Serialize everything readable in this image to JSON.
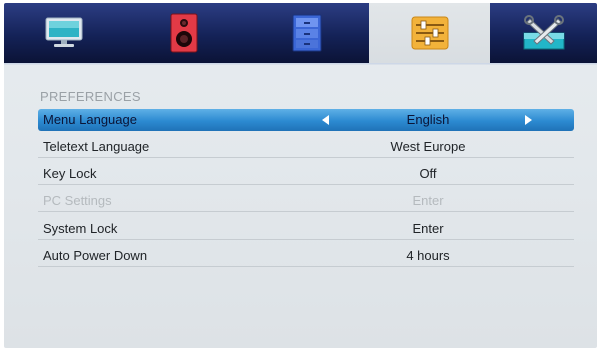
{
  "tabs": [
    {
      "icon": "monitor-icon",
      "active": false
    },
    {
      "icon": "speaker-icon",
      "active": false
    },
    {
      "icon": "cabinet-icon",
      "active": false
    },
    {
      "icon": "sliders-icon",
      "active": true
    },
    {
      "icon": "tools-icon",
      "active": false
    }
  ],
  "section_title": "PREFERENCES",
  "rows": [
    {
      "label": "Menu Language",
      "value": "English"
    },
    {
      "label": "Teletext Language",
      "value": "West Europe"
    },
    {
      "label": "Key Lock",
      "value": "Off"
    },
    {
      "label": "PC Settings",
      "value": "Enter"
    },
    {
      "label": "System Lock",
      "value": "Enter"
    },
    {
      "label": "Auto Power Down",
      "value": "4 hours"
    }
  ],
  "colors": {
    "topbar": "#142257",
    "selected_row": "#2c8ad1",
    "active_tab": "#dde1e5"
  }
}
